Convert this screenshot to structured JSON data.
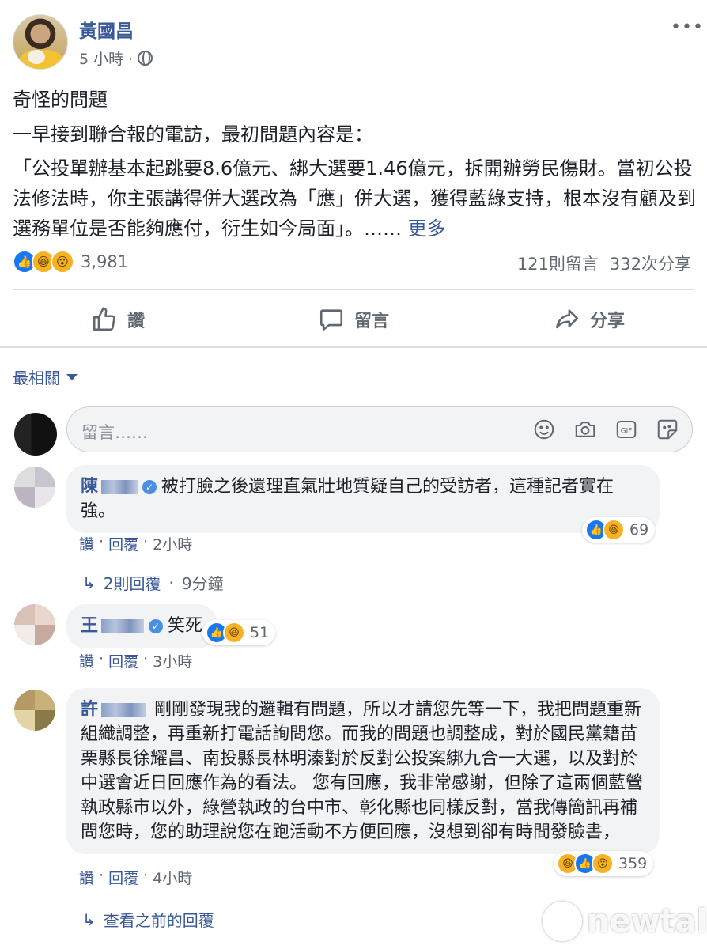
{
  "post": {
    "author": "黃國昌",
    "time": "5 小時 ·",
    "title": "奇怪的問題",
    "line1": "一早接到聯合報的電訪，最初問題內容是：",
    "quote": "「公投單辦基本起跳要8.6億元、綁大選要1.46億元，拆開辦勞民傷財。當初公投法修法時，你主張講得併大選改為「應」併大選，獲得藍綠支持，根本沒有顧及到選務單位是否能夠應付，衍生如今局面」。……",
    "see_more": "更多",
    "reaction_count": "3,981",
    "comments_count": "121則留言",
    "shares_count": "332次分享"
  },
  "actions": {
    "like": "讚",
    "comment": "留言",
    "share": "分享"
  },
  "sort_label": "最相關",
  "comment_input": {
    "placeholder": "留言……"
  },
  "comments": [
    {
      "name": "陳",
      "text": "被打臉之後還理直氣壯地質疑自己的受訪者，這種記者實在強。",
      "reactions": "69",
      "like": "讚",
      "reply": "回覆",
      "time": "2小時",
      "replies_label": "2則回覆",
      "replies_time": "9分鐘"
    },
    {
      "name": "王",
      "text": "笑死",
      "reactions": "51",
      "like": "讚",
      "reply": "回覆",
      "time": "3小時"
    },
    {
      "name": "許",
      "text": "剛剛發現我的邏輯有問題，所以才請您先等一下，我把問題重新組織調整，再重新打電話詢問您。而我的問題也調整成，對於國民黨籍苗栗縣長徐耀昌、南投縣長林明溱對於反對公投案綁九合一大選，以及對於中選會近日回應作為的看法。 您有回應，我非常感謝，但除了這兩個藍營執政縣市以外，綠營執政的台中市、彰化縣也同樣反對，當我傳簡訊再補問您時，您的助理說您在跑活動不方便回應，沒想到卻有時間發臉書，",
      "reactions": "359",
      "like": "讚",
      "reply": "回覆",
      "time": "4小時"
    }
  ],
  "view_previous": "查看之前的回覆",
  "watermark": "newtalk",
  "colors": {
    "link": "#385898",
    "meta": "#606770",
    "like_blue": "#1877f2",
    "emoji_yellow": "#f7b125"
  }
}
